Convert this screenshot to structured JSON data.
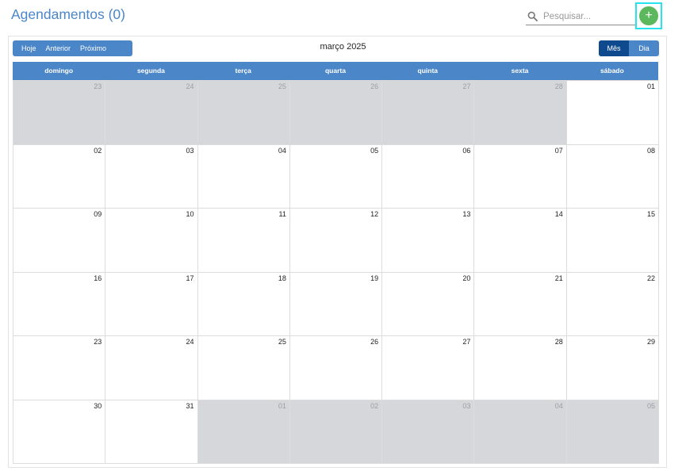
{
  "header": {
    "title": "Agendamentos (0)"
  },
  "search": {
    "placeholder": "Pesquisar..."
  },
  "add_button": {
    "label": "+"
  },
  "toolbar": {
    "nav": [
      "Hoje",
      "Anterior",
      "Próximo"
    ],
    "month_title": "março 2025",
    "views": [
      {
        "label": "Mês",
        "active": true
      },
      {
        "label": "Dia",
        "active": false
      }
    ]
  },
  "calendar": {
    "weekdays": [
      "domingo",
      "segunda",
      "terça",
      "quarta",
      "quinta",
      "sexta",
      "sábado"
    ],
    "weeks": [
      [
        {
          "d": "23",
          "o": true
        },
        {
          "d": "24",
          "o": true
        },
        {
          "d": "25",
          "o": true
        },
        {
          "d": "26",
          "o": true
        },
        {
          "d": "27",
          "o": true
        },
        {
          "d": "28",
          "o": true
        },
        {
          "d": "01",
          "o": false
        }
      ],
      [
        {
          "d": "02",
          "o": false
        },
        {
          "d": "03",
          "o": false
        },
        {
          "d": "04",
          "o": false
        },
        {
          "d": "05",
          "o": false
        },
        {
          "d": "06",
          "o": false
        },
        {
          "d": "07",
          "o": false
        },
        {
          "d": "08",
          "o": false
        }
      ],
      [
        {
          "d": "09",
          "o": false
        },
        {
          "d": "10",
          "o": false
        },
        {
          "d": "11",
          "o": false
        },
        {
          "d": "12",
          "o": false
        },
        {
          "d": "13",
          "o": false
        },
        {
          "d": "14",
          "o": false
        },
        {
          "d": "15",
          "o": false
        }
      ],
      [
        {
          "d": "16",
          "o": false
        },
        {
          "d": "17",
          "o": false
        },
        {
          "d": "18",
          "o": false
        },
        {
          "d": "19",
          "o": false
        },
        {
          "d": "20",
          "o": false
        },
        {
          "d": "21",
          "o": false
        },
        {
          "d": "22",
          "o": false
        }
      ],
      [
        {
          "d": "23",
          "o": false
        },
        {
          "d": "24",
          "o": false
        },
        {
          "d": "25",
          "o": false
        },
        {
          "d": "26",
          "o": false
        },
        {
          "d": "27",
          "o": false
        },
        {
          "d": "28",
          "o": false
        },
        {
          "d": "29",
          "o": false
        }
      ],
      [
        {
          "d": "30",
          "o": false
        },
        {
          "d": "31",
          "o": false
        },
        {
          "d": "01",
          "o": true
        },
        {
          "d": "02",
          "o": true
        },
        {
          "d": "03",
          "o": true
        },
        {
          "d": "04",
          "o": true
        },
        {
          "d": "05",
          "o": true
        }
      ]
    ]
  },
  "colors": {
    "accent": "#4a86c8",
    "active_view": "#0f4a8e",
    "add_button": "#5cb85c",
    "focus_ring": "#27e3ef",
    "other_month": "#d5d7db"
  }
}
